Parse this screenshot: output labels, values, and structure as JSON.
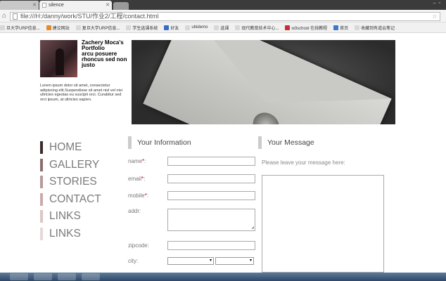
{
  "browser": {
    "tabs": [
      {
        "label": ""
      },
      {
        "label": "silence"
      }
    ],
    "url": "file:///H:/danny/work/STU/作业2/工程/contact.html",
    "bookmarks": [
      {
        "label": "旦大学URP信息...",
        "color": "#d8d8d8"
      },
      {
        "label": "建议网站",
        "color": "#e48a2a"
      },
      {
        "label": "复旦大学URP信息...",
        "color": "#d8d8d8"
      },
      {
        "label": "学生选课系统",
        "color": "#d8d8d8"
      },
      {
        "label": "好友",
        "color": "#3a6bc8"
      },
      {
        "label": "ubidemo",
        "color": "#d8d8d8"
      },
      {
        "label": "选课",
        "color": "#d8d8d8"
      },
      {
        "label": "现代教育技术中心...",
        "color": "#d8d8d8"
      },
      {
        "label": "w3school 在线教程",
        "color": "#c83030"
      },
      {
        "label": "首页",
        "color": "#3a7ac8"
      },
      {
        "label": "收藏到有道云笔记",
        "color": "#d8d8d8"
      }
    ]
  },
  "profile": {
    "name": "Zachery Moca's Portfolio",
    "tagline": "arcu posuere rhoncus sed non justo",
    "bio": "Lorem ipsum dolor sit amet, consectetur adipiscing elit.Suspendisse sit amet nisl vel nisi ultricies egestas eu suscipit orci. Curabitur sed orci ipsum, at ultricies sapien."
  },
  "nav": [
    {
      "label": "HOME",
      "color": "#3a2a2a"
    },
    {
      "label": "GALLERY",
      "color": "#8a6e6e"
    },
    {
      "label": "STORIES",
      "color": "#b89a9a"
    },
    {
      "label": "CONTACT",
      "color": "#c9aaaa"
    },
    {
      "label": "LINKS",
      "color": "#dcc6c6"
    },
    {
      "label": "LINKS",
      "color": "#e7d8d8"
    }
  ],
  "form": {
    "title": "Your Information",
    "fields": {
      "name": "name",
      "email": "email",
      "mobile": "mobile",
      "addr": "addr:",
      "zipcode": "zipcode:",
      "city": "city:"
    },
    "required_mark": "*",
    "colon": ":"
  },
  "message": {
    "title": "Your Message",
    "placeholder": "Please leave your message here:"
  }
}
